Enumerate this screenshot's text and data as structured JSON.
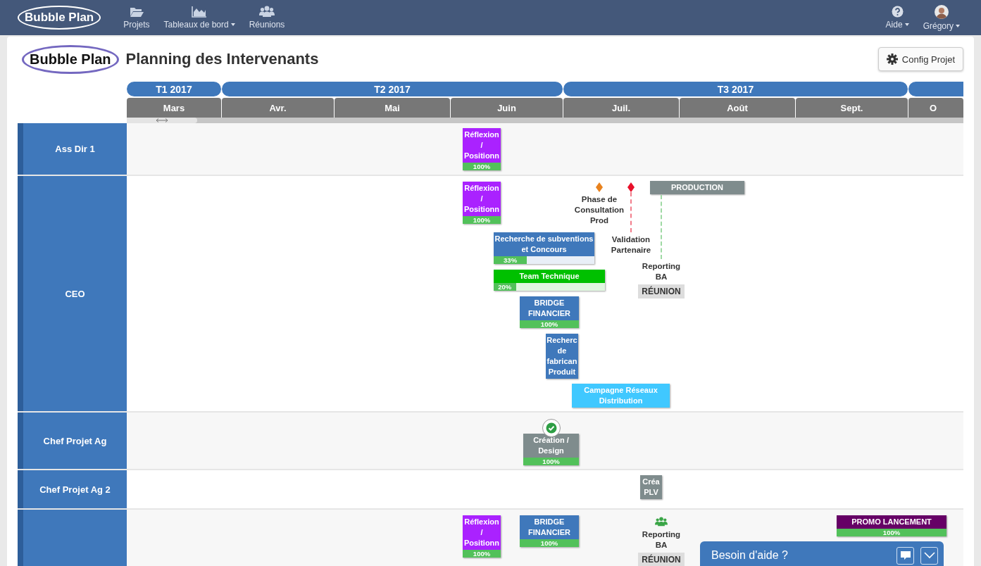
{
  "navbar": {
    "logo": "Bubble Plan",
    "items": [
      {
        "label": "Projets",
        "dropdown": false
      },
      {
        "label": "Tableaux de bord",
        "dropdown": true
      },
      {
        "label": "Réunions",
        "dropdown": false
      }
    ],
    "right": [
      {
        "label": "Aide",
        "dropdown": true
      },
      {
        "label": "Grégory",
        "dropdown": true
      }
    ]
  },
  "header": {
    "logo": "Bubble Plan",
    "title": "Planning des Intervenants",
    "config_button": "Config Projet"
  },
  "quarters": [
    "T1 2017",
    "T2 2017",
    "T3 2017"
  ],
  "months": [
    "Mars",
    "Avr.",
    "Mai",
    "Juin",
    "Juil.",
    "Août",
    "Sept.",
    "O"
  ],
  "rows": [
    {
      "label": "Ass Dir 1",
      "items": [
        {
          "kind": "task",
          "title": "Réflexion / Positionn",
          "color": "#aa22ff",
          "level": 1,
          "percent": "100%"
        }
      ]
    },
    {
      "label": "CEO",
      "items": [
        {
          "kind": "task",
          "title": "Réflexion / Positionn",
          "color": "#aa22ff",
          "level": 1,
          "percent": "100%"
        },
        {
          "kind": "milestone",
          "label": "Phase de Consultation Prod",
          "color": "#e8821e",
          "dashed_line": false
        },
        {
          "kind": "milestone",
          "label": "Validation Partenaire",
          "color": "#e8102a",
          "dashed_line": true
        },
        {
          "kind": "task",
          "title": "PRODUCTION",
          "color": "#7f8c8d"
        },
        {
          "kind": "meeting",
          "label": "Reporting BA",
          "tag": "RÉUNION",
          "connector": true
        },
        {
          "kind": "task",
          "title": "Recherche de subventions et Concours",
          "color": "#3f78bb",
          "level": 0.33,
          "percent": "33%"
        },
        {
          "kind": "task",
          "title": "Team Technique",
          "color": "#00c000",
          "level": 0.2,
          "percent": "20%"
        },
        {
          "kind": "task",
          "title": "BRIDGE FINANCIER",
          "color": "#3f78bb",
          "level": 1,
          "percent": "100%"
        },
        {
          "kind": "task",
          "title": "Recherc de fabrican Produit",
          "color": "#3f78bb"
        },
        {
          "kind": "task",
          "title": "Campagne Réseaux Distribution",
          "color": "#40c8ff"
        }
      ]
    },
    {
      "label": "Chef Projet Ag",
      "items": [
        {
          "kind": "task",
          "title": "Création / Design",
          "color": "#7f8c8d",
          "level": 1,
          "percent": "100%",
          "validated": true
        }
      ]
    },
    {
      "label": "Chef Projet Ag 2",
      "items": [
        {
          "kind": "task",
          "title": "Créa PLV",
          "color": "#7f8c8d"
        }
      ]
    },
    {
      "items": [
        {
          "kind": "task",
          "title": "Réflexion / Positionn",
          "color": "#aa22ff",
          "level": 1,
          "percent": "100%"
        },
        {
          "kind": "task",
          "title": "BRIDGE FINANCIER",
          "color": "#3f78bb",
          "level": 1,
          "percent": "100%"
        },
        {
          "kind": "meeting",
          "label": "Reporting BA",
          "tag": "RÉUNION",
          "connector": false
        },
        {
          "kind": "task",
          "title": "PROMO LANCEMENT",
          "color": "#660066",
          "level": 1,
          "percent": "100%"
        }
      ]
    }
  ],
  "help_widget": {
    "title": "Besoin d'aide ?"
  }
}
